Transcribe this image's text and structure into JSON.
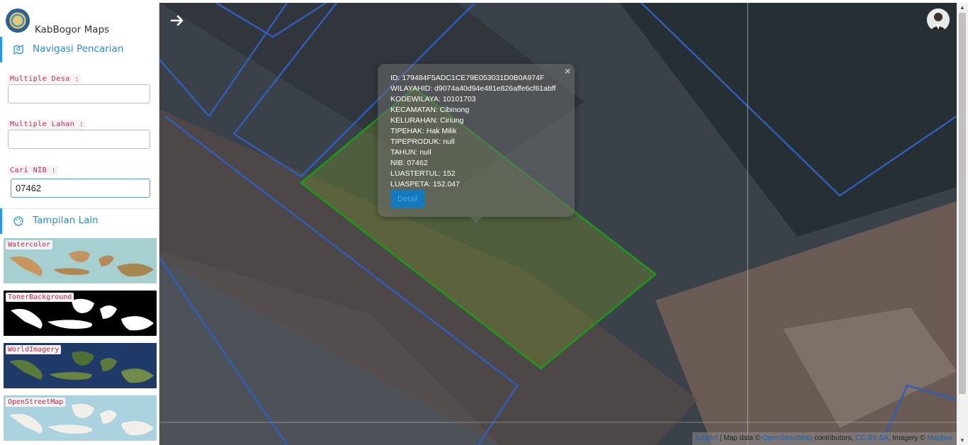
{
  "app": {
    "name": "KabBogor Maps"
  },
  "sidebar": {
    "nav_section": {
      "label": "Navigasi Pencarian",
      "icon": "map-search-icon"
    },
    "fields": [
      {
        "label": "Multiple Desa :",
        "value": "",
        "placeholder": ""
      },
      {
        "label": "Multiple Lahan :",
        "value": "",
        "placeholder": ""
      },
      {
        "label": "Cari NIB :",
        "value": "07462",
        "placeholder": ""
      }
    ],
    "other_section": {
      "label": "Tampilan Lain",
      "icon": "palette-icon"
    },
    "layers": [
      {
        "label": "Watercolor"
      },
      {
        "label": "TonerBackground"
      },
      {
        "label": "WorldImagery"
      },
      {
        "label": "OpenStreetMap"
      }
    ]
  },
  "map": {
    "toggle_icon": "arrow-right-icon",
    "popup": {
      "close": "×",
      "rows": [
        "ID: 179484F5ADC1CE79E053031D0B0A974F",
        "WILAYAHID: d9074a40d94e481e826affe6cf61abff",
        "KODEWILAYA: 10101703",
        "KECAMATAN: Cibinong",
        "KELURAHAN: Ciriung",
        "TIPEHAK: Hak Milik",
        "TIPEPRODUK: null",
        "TAHUN: null",
        "NIB: 07462",
        "LUASTERTUL: 152",
        "LUASPETA: 152.047"
      ],
      "detail_label": "Detail"
    },
    "attribution": {
      "leaflet": "Leaflet",
      "sep": " | Map data © ",
      "osm": "OpenStreetMap",
      "contrib": " contributors, ",
      "license": "CC-BY-SA",
      "imagery": ", Imagery © ",
      "mapbox": "Mapbox"
    }
  },
  "colors": {
    "accent": "#2196f3",
    "parcel_outline": "#2f5db8",
    "selected_parcel": "#1a9a1a"
  }
}
